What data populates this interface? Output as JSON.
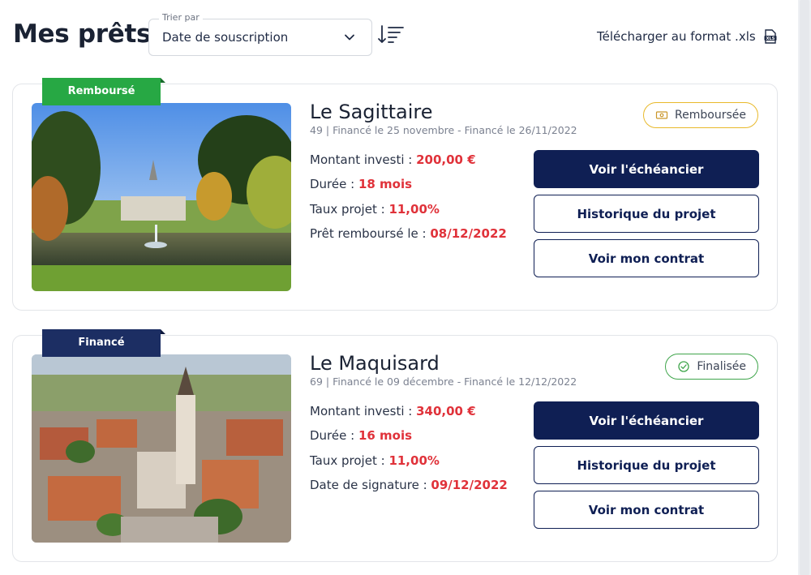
{
  "header": {
    "title": "Mes prêts",
    "sort_legend": "Trier par",
    "sort_value": "Date de souscription",
    "download_label": "Télécharger au format .xls"
  },
  "loans": [
    {
      "ribbon": "Remboursé",
      "name": "Le Sagittaire",
      "subtitle": "49 | Financé le 25 novembre - Financé le 26/11/2022",
      "status": "Remboursée",
      "details": [
        {
          "label": "Montant investi : ",
          "value": "200,00 €"
        },
        {
          "label": "Durée : ",
          "value": "18 mois"
        },
        {
          "label": "Taux projet : ",
          "value": "11,00%"
        },
        {
          "label": "Prêt remboursé le : ",
          "value": "08/12/2022"
        }
      ],
      "buttons": {
        "schedule": "Voir l'échéancier",
        "history": "Historique du projet",
        "contract": "Voir mon contrat"
      }
    },
    {
      "ribbon": "Financé",
      "name": "Le Maquisard",
      "subtitle": "69 | Financé le 09 décembre - Financé le 12/12/2022",
      "status": "Finalisée",
      "details": [
        {
          "label": "Montant investi : ",
          "value": "340,00 €"
        },
        {
          "label": "Durée : ",
          "value": "16 mois"
        },
        {
          "label": "Taux projet : ",
          "value": "11,00%"
        },
        {
          "label": "Date de signature : ",
          "value": "09/12/2022"
        }
      ],
      "buttons": {
        "schedule": "Voir l'échéancier",
        "history": "Historique du projet",
        "contract": "Voir mon contrat"
      }
    }
  ],
  "icons": {
    "sort_chevron": "chevron-down-icon",
    "sort_order": "sort-descending-icon",
    "download": "xls-file-icon",
    "status_1": "cash-icon",
    "status_2": "check-circle-icon"
  },
  "colors": {
    "primary": "#0f1f54",
    "accent_value": "#e0323a",
    "ribbon_repaid": "#27a844",
    "ribbon_funded": "#1c2e63",
    "status_repaid_border": "#e8b92b",
    "status_final_border": "#3fa54b"
  }
}
